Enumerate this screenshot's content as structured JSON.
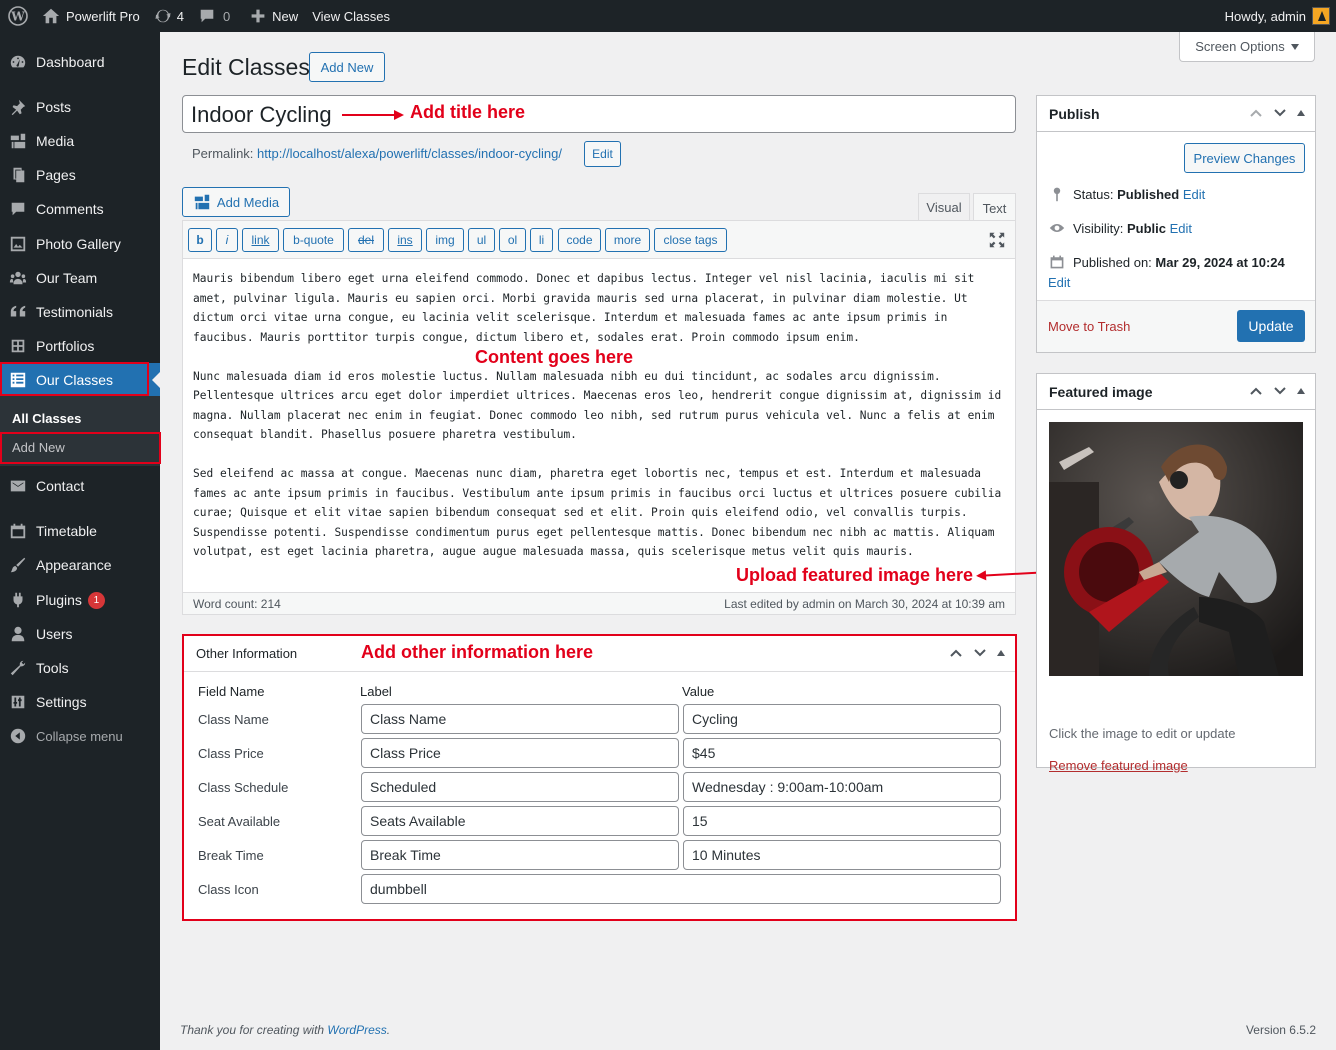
{
  "adminbar": {
    "site_name": "Powerlift Pro",
    "updates": "4",
    "comments": "0",
    "new_label": "New",
    "view_label": "View Classes",
    "howdy": "Howdy, admin"
  },
  "sidebar": {
    "items": [
      "Dashboard",
      "Posts",
      "Media",
      "Pages",
      "Comments",
      "Photo Gallery",
      "Our Team",
      "Testimonials",
      "Portfolios",
      "Our Classes",
      "Contact",
      "Timetable",
      "Appearance",
      "Plugins",
      "Users",
      "Tools",
      "Settings",
      "Collapse menu"
    ],
    "plugins_badge": "1",
    "submenu": [
      "All Classes",
      "Add New"
    ]
  },
  "screen_options": "Screen Options",
  "page": {
    "heading": "Edit Classes",
    "add_new": "Add New"
  },
  "title": {
    "value": "Indoor Cycling"
  },
  "permalink": {
    "label": "Permalink:",
    "url": "http://localhost/alexa/powerlift/classes/indoor-cycling/",
    "edit": "Edit"
  },
  "editor": {
    "add_media": "Add Media",
    "tabs": [
      "Visual",
      "Text"
    ],
    "quicktags": [
      "b",
      "i",
      "link",
      "b-quote",
      "del",
      "ins",
      "img",
      "ul",
      "ol",
      "li",
      "code",
      "more",
      "close tags"
    ],
    "paragraphs": [
      "Mauris bibendum libero eget urna eleifend commodo. Donec et dapibus lectus. Integer vel nisl lacinia, iaculis mi sit amet, pulvinar ligula. Mauris eu sapien orci. Morbi gravida mauris sed urna placerat, in pulvinar diam molestie. Ut dictum orci vitae urna congue, eu lacinia velit scelerisque. Interdum et malesuada fames ac ante ipsum primis in faucibus. Mauris porttitor turpis congue, dictum libero et, sodales erat. Proin commodo ipsum enim.",
      "Nunc malesuada diam id eros molestie luctus. Nullam malesuada nibh eu dui tincidunt, ac sodales arcu dignissim. Pellentesque ultrices arcu eget dolor imperdiet ultrices. Maecenas eros leo, hendrerit congue dignissim at, dignissim id magna. Nullam placerat nec enim in feugiat. Donec commodo leo nibh, sed rutrum purus vehicula vel. Nunc a felis at enim consequat blandit. Phasellus posuere pharetra vestibulum.",
      "Sed eleifend ac massa at congue. Maecenas nunc diam, pharetra eget lobortis nec, tempus et est. Interdum et malesuada fames ac ante ipsum primis in faucibus. Vestibulum ante ipsum primis in faucibus orci luctus et ultrices posuere cubilia curae; Quisque et elit vitae sapien bibendum consequat sed et elit. Proin quis eleifend odio, vel convallis turpis. Suspendisse potenti. Suspendisse condimentum purus eget pellentesque mattis. Donec bibendum nec nibh ac mattis. Aliquam volutpat, est eget lacinia pharetra, augue augue malesuada massa, quis scelerisque metus velit quis mauris."
    ],
    "word_count": "Word count: 214",
    "last_edited": "Last edited by admin on March 30, 2024 at 10:39 am"
  },
  "annotations": {
    "title": "Add title here",
    "content": "Content goes here",
    "featured": "Upload featured image here",
    "other": "Add other information here"
  },
  "publish": {
    "title": "Publish",
    "preview": "Preview Changes",
    "status_label": "Status:",
    "status_value": "Published",
    "status_edit": "Edit",
    "visibility_label": "Visibility:",
    "visibility_value": "Public",
    "visibility_edit": "Edit",
    "published_label": "Published on:",
    "published_value": "Mar 29, 2024 at 10:24",
    "published_edit": "Edit",
    "trash": "Move to Trash",
    "update": "Update"
  },
  "featured": {
    "title": "Featured image",
    "hint": "Click the image to edit or update",
    "remove": "Remove featured image"
  },
  "other_info": {
    "title": "Other Information",
    "headers": [
      "Field Name",
      "Label",
      "Value"
    ],
    "rows": [
      {
        "name": "Class Name",
        "label": "Class Name",
        "value": "Cycling"
      },
      {
        "name": "Class Price",
        "label": "Class Price",
        "value": "$45"
      },
      {
        "name": "Class Schedule",
        "label": "Scheduled",
        "value": "Wednesday : 9:00am-10:00am"
      },
      {
        "name": "Seat Available",
        "label": "Seats Available",
        "value": "15"
      },
      {
        "name": "Break Time",
        "label": "Break Time",
        "value": "10 Minutes"
      },
      {
        "name": "Class Icon",
        "label": "dumbbell",
        "value": ""
      }
    ]
  },
  "footer": {
    "thanks": "Thank you for creating with",
    "wp_link": "WordPress",
    "period": ".",
    "version": "Version 6.5.2"
  },
  "colors": {
    "accent": "#2271b1",
    "annotation": "#e2001a",
    "sidebar_bg": "#1d2327"
  }
}
